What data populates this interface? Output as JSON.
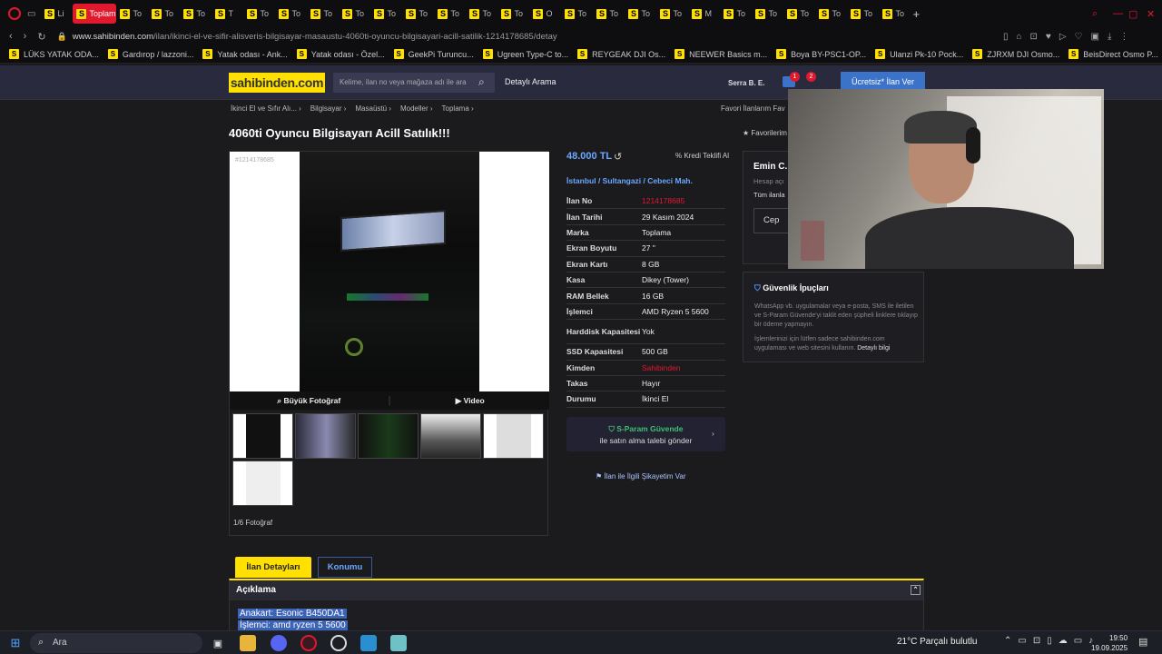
{
  "browser": {
    "tabs": [
      {
        "label": "Li",
        "active": false
      },
      {
        "label": "Toplam",
        "active": true
      },
      {
        "label": "To"
      },
      {
        "label": "To"
      },
      {
        "label": "To"
      },
      {
        "label": "T"
      },
      {
        "label": "To"
      },
      {
        "label": "To"
      },
      {
        "label": "To"
      },
      {
        "label": "To"
      },
      {
        "label": "To"
      },
      {
        "label": "To"
      },
      {
        "label": "To"
      },
      {
        "label": "To"
      },
      {
        "label": "To"
      },
      {
        "label": "O"
      },
      {
        "label": "To"
      },
      {
        "label": "To"
      },
      {
        "label": "To"
      },
      {
        "label": "To"
      },
      {
        "label": "M"
      },
      {
        "label": "To"
      },
      {
        "label": "To"
      },
      {
        "label": "To"
      },
      {
        "label": "To"
      },
      {
        "label": "To"
      },
      {
        "label": "To"
      }
    ],
    "url_host": "www.sahibinden.com",
    "url_path": "/ilan/ikinci-el-ve-sifir-alisveris-bilgisayar-masaustu-4060ti-oyuncu-bilgisayari-acill-satilik-1214178685/detay",
    "bookmarks": [
      "LÜKS YATAK ODA...",
      "Gardırop / lazzoni...",
      "Yatak odası - Ank...",
      "Yatak odası - Özel...",
      "GeekPi Turuncu...",
      "Ugreen Type-C to...",
      "REYGEAK DJI Os...",
      "NEEWER Basics m...",
      "Boya BY-PSC1-OP...",
      "Ulanzi Pk-10 Pock...",
      "ZJRXM DJI Osmo...",
      "BeisDirect Osmo P..."
    ]
  },
  "site": {
    "logo": "sahibinden.com",
    "search_placeholder": "Kelime, ilan no veya mağaza adı ile ara",
    "detailed_search": "Detaylı Arama",
    "user": "Serra B. E.",
    "badge1": "1",
    "badge2": "2",
    "free_ad": "Ücretsiz* İlan Ver",
    "breadcrumb": [
      "İkinci El ve Sıfır Alı... ›",
      "Bilgisayar ›",
      "Masaüstü ›",
      "Modeller ›",
      "Toplama ›"
    ],
    "fav_links": "Favori İlanlarım    Fav"
  },
  "listing": {
    "title": "4060ti Oyuncu Bilgisayarı Acill Satılık!!!",
    "favorites": "★ Favorilerim",
    "image_id": "#1214178685",
    "big_photo": "Büyük Fotoğraf",
    "video": "Video",
    "photo_count": "1/6 Fotoğraf",
    "price": "48.000 TL",
    "kredi": "Kredi Teklifi Al",
    "location": "İstanbul  /  Sultangazi  /  Cebeci Mah.",
    "specs": [
      {
        "k": "İlan No",
        "v": "1214178685",
        "red": true
      },
      {
        "k": "İlan Tarihi",
        "v": "29 Kasım 2024"
      },
      {
        "k": "Marka",
        "v": "Toplama"
      },
      {
        "k": "Ekran Boyutu",
        "v": "27 \""
      },
      {
        "k": "Ekran Kartı",
        "v": "8 GB"
      },
      {
        "k": "Kasa",
        "v": "Dikey (Tower)"
      },
      {
        "k": "RAM Bellek",
        "v": "16 GB"
      },
      {
        "k": "İşlemci",
        "v": "AMD Ryzen 5 5600"
      },
      {
        "k": "Harddisk Kapasitesi",
        "v": "Yok",
        "tall": true
      },
      {
        "k": "SSD Kapasitesi",
        "v": "500 GB"
      },
      {
        "k": "Kimden",
        "v": "Sahibinden",
        "red": true
      },
      {
        "k": "Takas",
        "v": "Hayır"
      },
      {
        "k": "Durumu",
        "v": "İkinci El"
      }
    ],
    "param_line1": "S-Param Güvende",
    "param_line2": "ile satın alma talebi gönder",
    "complain": "İlan ile İlgili Şikayetim Var",
    "seller_name": "Emin C.",
    "seller_sub": "Hesap açı",
    "seller_all": "Tüm ilanla",
    "seller_phone": "Cep",
    "safety_title": "Güvenlik İpuçları",
    "safety_p1": "WhatsApp vb. uygulamalar veya e-posta, SMS ile iletilen ve S-Param Güvende'yi taklit eden şüpheli linklere tıklayıp bir ödeme yapmayın.",
    "safety_p2": "İşlemlerinizi için lütfen sadece sahibinden.com uygulaması ve web sitesini kullanın.",
    "safety_more": "Detaylı bilgi",
    "tab_details": "İlan Detayları",
    "tab_location": "Konumu",
    "desc_title": "Açıklama",
    "desc_line1": "Anakart: Esonic B450DA1",
    "desc_line2": "İşlemci: amd ryzen 5 5600"
  },
  "taskbar": {
    "search": "Ara",
    "weather": "21°C  Parçalı bulutlu",
    "time": "19:50",
    "date": "19.09.2025"
  },
  "colors": {
    "brand": "#ffe000",
    "accent": "#6aa7ff",
    "red": "#e0192f"
  }
}
